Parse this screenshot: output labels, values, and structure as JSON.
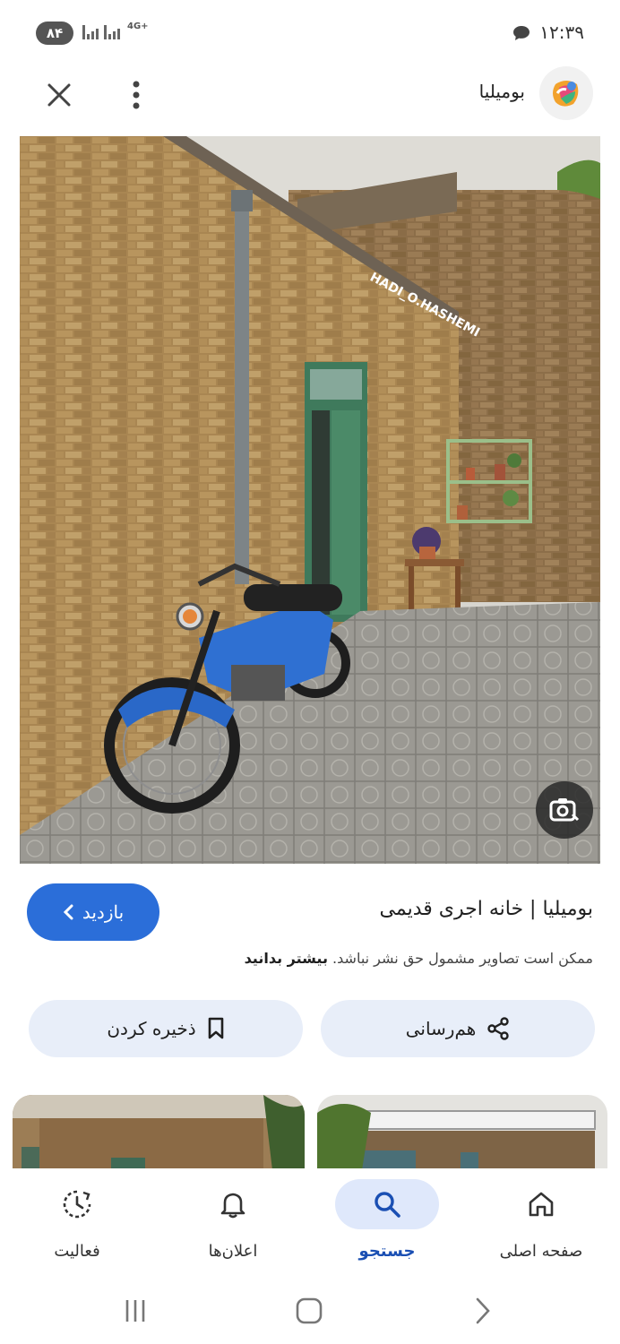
{
  "status_bar": {
    "time": "۱۲:۳۹",
    "battery": "۸۴",
    "network": "4G+"
  },
  "header": {
    "site_name": "بومیلیا",
    "close_icon": "close-icon",
    "more_icon": "more-vert-icon"
  },
  "image": {
    "watermark": "HADI_O.HASHEMI",
    "lens_icon": "lens-search-icon"
  },
  "result": {
    "title": "بومیلیا | خانه اجری قدیمی",
    "visit_label": "بازدید",
    "copyright_text": "ممکن است تصاویر مشمول حق نشر نباشد.",
    "learn_more": "بیشتر بدانید"
  },
  "actions": {
    "share_label": "هم‌رسانی",
    "save_label": "ذخیره کردن"
  },
  "bottom_nav": {
    "items": [
      {
        "label": "صفحه اصلی",
        "icon": "home-icon"
      },
      {
        "label": "جستجو",
        "icon": "search-icon",
        "active": true
      },
      {
        "label": "اعلان‌ها",
        "icon": "bell-icon"
      },
      {
        "label": "فعالیت",
        "icon": "activity-icon"
      }
    ]
  },
  "colors": {
    "accent": "#2b6ed9",
    "chip_bg": "#e8eef9",
    "active_nav": "#dfe8fb"
  }
}
